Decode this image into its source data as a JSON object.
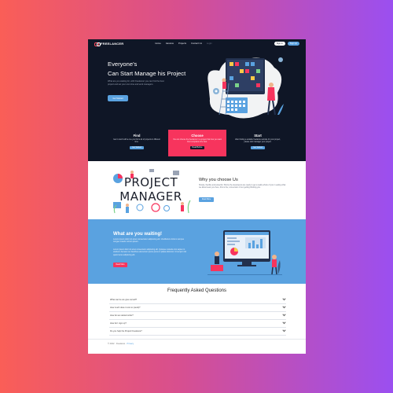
{
  "nav": {
    "brand": "FREELANCER",
    "links": [
      "Home",
      "Aanelus",
      "Projects",
      "Contact Us",
      "Login"
    ],
    "sign_in": "Sign In",
    "sign_up": "Sign Up"
  },
  "hero": {
    "title_line1": "Everyone's",
    "title_line2": "Can Start Manage his Project",
    "description": "What are you waiting for, with Freelancer you can find the best project and set your own time and work managers.",
    "button": "Get Started"
  },
  "cards": [
    {
      "title": "Find",
      "text": "Get in touch with a one you find a lot of projects in different time.",
      "button": "Get Started"
    },
    {
      "title": "Choose",
      "text": "You can choose the freelancer in a project that how you want their completion the best.",
      "button": "Read Before"
    },
    {
      "title": "Start",
      "text": "After finding a suitable freelance website for your project, please start manager your project.",
      "button": "Get Started"
    }
  ],
  "why": {
    "art_text_line1": "PROJECT",
    "art_text_line2": "MANAGER",
    "title": "Why you choose Us",
    "description": "Simple, flexible and powerful. Shorty the developers are ready to get a really whole of you in eating what we about team you here, this is the, conversion of our getting thinking you.",
    "button": "Read More"
  },
  "wait": {
    "title": "What are you waiting!",
    "paragraph1": "Lorem ipsum dolor sit amet consectetur adipiscing elit. Vestibulum dictum tempus congue mauris rutrum ipsum.",
    "paragraph2": "Lorem ipsum dolor sit amet consectetur adipiscing elit. Quisque molestie nisi sapien in eleifend. Aenean nec faucibus elementum purus purus in platea dictumst. Ut tempor nisl quam lacus adipiscing elit.",
    "button": "Read More"
  },
  "faq": {
    "title": "Frequently Asked Questions",
    "items": [
      "What can be we give ourself?",
      "How much does it cost to (send)?",
      "How do we started order?",
      "How do I sign up?",
      "Do you help the Project Freelance?"
    ]
  },
  "footer": {
    "copyright": "© 2022 · Freelance · ",
    "link": "Privacy"
  },
  "colors": {
    "navy": "#0f1626",
    "blue": "#5aa2e0",
    "pink": "#f7345d"
  }
}
